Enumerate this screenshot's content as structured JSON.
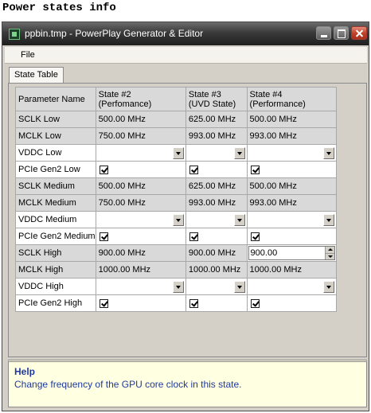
{
  "caption": "Power states info",
  "window": {
    "title": "ppbin.tmp - PowerPlay Generator & Editor"
  },
  "menu": {
    "file": "File"
  },
  "tab": {
    "label": "State Table"
  },
  "table": {
    "headers": [
      "Parameter Name",
      "State #2\n(Perfomance)",
      "State #3\n(UVD State)",
      "State #4\n(Performance)"
    ],
    "header_lines": {
      "c0": "Parameter Name",
      "c1a": "State #2",
      "c1b": "(Perfomance)",
      "c2a": "State #3",
      "c2b": "(UVD State)",
      "c3a": "State #4",
      "c3b": "(Performance)"
    },
    "rows": [
      {
        "name": "SCLK Low",
        "type": "text",
        "values": [
          "500.00 MHz",
          "625.00 MHz",
          "500.00 MHz"
        ]
      },
      {
        "name": "MCLK Low",
        "type": "text",
        "values": [
          "750.00 MHz",
          "993.00 MHz",
          "993.00 MHz"
        ]
      },
      {
        "name": "VDDC Low",
        "type": "combo",
        "values": [
          "",
          "",
          ""
        ]
      },
      {
        "name": "PCIe Gen2  Low",
        "type": "check",
        "values": [
          true,
          true,
          true
        ]
      },
      {
        "name": "SCLK Medium",
        "type": "text",
        "values": [
          "500.00 MHz",
          "625.00 MHz",
          "500.00 MHz"
        ]
      },
      {
        "name": "MCLK Medium",
        "type": "text",
        "values": [
          "750.00 MHz",
          "993.00 MHz",
          "993.00 MHz"
        ]
      },
      {
        "name": "VDDC Medium",
        "type": "combo",
        "values": [
          "",
          "",
          ""
        ]
      },
      {
        "name": "PCIe Gen2  Medium",
        "type": "check",
        "values": [
          true,
          true,
          true
        ]
      },
      {
        "name": "SCLK High",
        "type": "text",
        "values": [
          "900.00 MHz",
          "900.00 MHz",
          "900.00"
        ]
      },
      {
        "name": "MCLK High",
        "type": "text",
        "values": [
          "1000.00 MHz",
          "1000.00 MHz",
          "1000.00 MHz"
        ]
      },
      {
        "name": "VDDC High",
        "type": "combo",
        "values": [
          "",
          "",
          ""
        ]
      },
      {
        "name": "PCIe Gen2  High",
        "type": "check",
        "values": [
          true,
          true,
          true
        ]
      }
    ]
  },
  "help": {
    "title": "Help",
    "text": "Change frequency of the GPU core clock in this state."
  }
}
